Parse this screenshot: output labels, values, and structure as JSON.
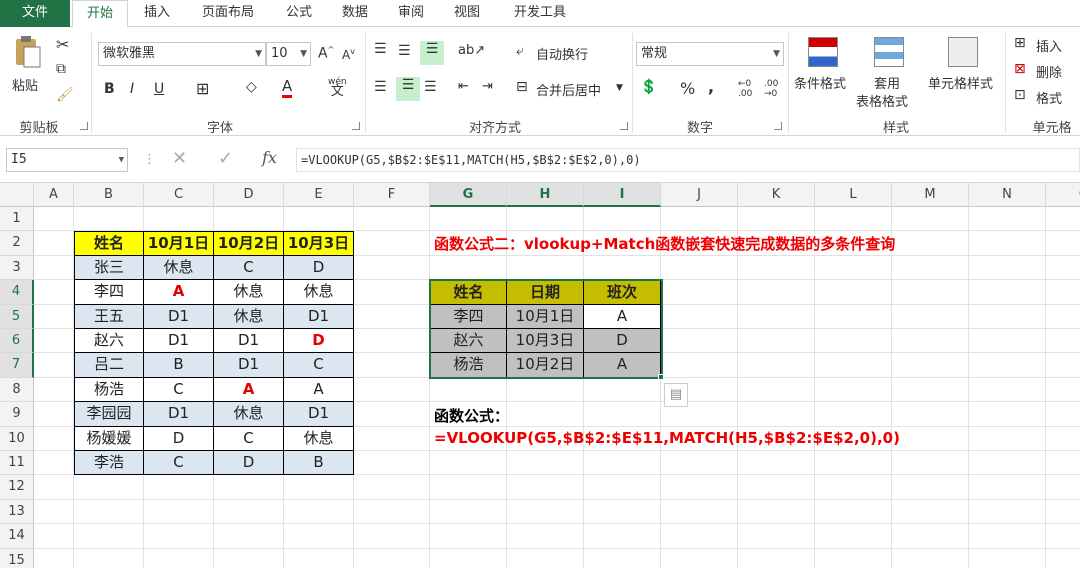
{
  "tabs": [
    "文件",
    "开始",
    "插入",
    "页面布局",
    "公式",
    "数据",
    "审阅",
    "视图",
    "开发工具"
  ],
  "clipboard": {
    "paste": "粘贴",
    "label": "剪贴板"
  },
  "font": {
    "name": "微软雅黑",
    "size": "10",
    "label": "字体",
    "bold": "B",
    "italic": "I",
    "underline": "U",
    "color_glyph": "A",
    "wen": "wén",
    "wen_char": "文"
  },
  "align": {
    "wrap": "自动换行",
    "merge": "合并后居中",
    "label": "对齐方式"
  },
  "number": {
    "format": "常规",
    "percent": "%",
    "comma": ",",
    "label": "数字"
  },
  "styles": {
    "cond": "条件格式",
    "table_1": "套用",
    "table_2": "表格格式",
    "cell": "单元格样式",
    "label": "样式"
  },
  "cells": {
    "insert": "插入",
    "delete": "删除",
    "format": "格式",
    "label": "单元格"
  },
  "formula_bar": {
    "name_box": "I5",
    "fx": "fx",
    "formula": "=VLOOKUP(G5,$B$2:$E$11,MATCH(H5,$B$2:$E$2,0),0)"
  },
  "columns": [
    "A",
    "B",
    "C",
    "D",
    "E",
    "F",
    "G",
    "H",
    "I",
    "J",
    "K",
    "L",
    "M",
    "N",
    "O"
  ],
  "rows": [
    "1",
    "2",
    "3",
    "4",
    "5",
    "6",
    "7",
    "8",
    "9",
    "10",
    "11",
    "12",
    "13",
    "14",
    "15"
  ],
  "table1": {
    "header": [
      "姓名",
      "10月1日",
      "10月2日",
      "10月3日"
    ],
    "rows": [
      [
        "张三",
        "休息",
        "C",
        "D"
      ],
      [
        "李四",
        "A",
        "休息",
        "休息"
      ],
      [
        "王五",
        "D1",
        "休息",
        "D1"
      ],
      [
        "赵六",
        "D1",
        "D1",
        "D"
      ],
      [
        "吕二",
        "B",
        "D1",
        "C"
      ],
      [
        "杨浩",
        "C",
        "A",
        "A"
      ],
      [
        "李园园",
        "D1",
        "休息",
        "D1"
      ],
      [
        "杨媛媛",
        "D",
        "C",
        "休息"
      ],
      [
        "李浩",
        "C",
        "D",
        "B"
      ]
    ]
  },
  "table2": {
    "header": [
      "姓名",
      "日期",
      "班次"
    ],
    "rows": [
      [
        "李四",
        "10月1日",
        "A"
      ],
      [
        "赵六",
        "10月3日",
        "D"
      ],
      [
        "杨浩",
        "10月2日",
        "A"
      ]
    ]
  },
  "notes": {
    "title": "函数公式二：vlookup+Match函数嵌套快速完成数据的多条件查询",
    "label": "函数公式：",
    "formula": "=VLOOKUP(G5,$B$2:$E$11,MATCH(H5,$B$2:$E$2,0),0)"
  },
  "colors": {
    "accent": "#217346",
    "yellow": "#ffff00",
    "blue_row": "#dce6f1",
    "olive": "#c4bd00",
    "gray": "#c0c0c0",
    "red": "#e00000"
  }
}
